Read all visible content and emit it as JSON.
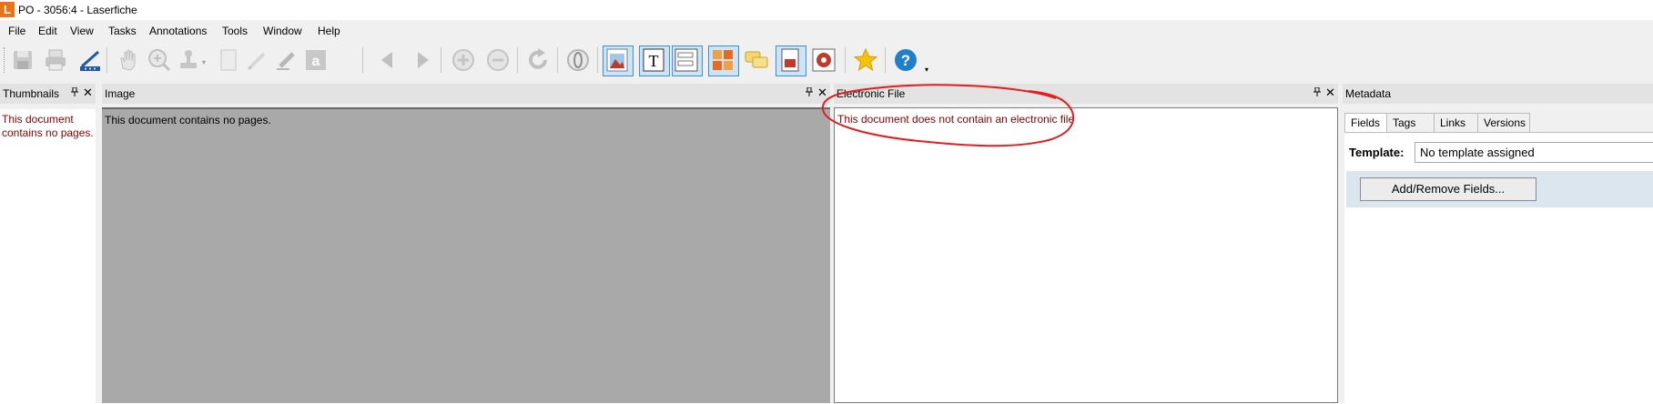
{
  "window": {
    "title": "PO - 3056:4 - Laserfiche",
    "logo_letter": "L",
    "accent": "#e8731a"
  },
  "menu": [
    "File",
    "Edit",
    "View",
    "Tasks",
    "Annotations",
    "Tools",
    "Window",
    "Help"
  ],
  "toolbar": {
    "icons": [
      "save-icon",
      "print-icon",
      "scan-icon",
      "hand-icon",
      "zoom-in-icon",
      "stamp-icon",
      "page-icon",
      "pencil-icon",
      "highlighter-icon",
      "text-annotation-icon",
      "previous-page-icon",
      "next-page-icon",
      "add-icon",
      "remove-icon",
      "refresh-icon",
      "ocr-icon",
      "image-pane-icon",
      "text-pane-icon",
      "metadata-pane-icon",
      "thumbnails-pane-icon",
      "annotations-pane-icon",
      "electronic-file-pane-icon",
      "settings-icon",
      "favorites-icon",
      "help-icon"
    ]
  },
  "panels": {
    "thumbnails": {
      "title": "Thumbnails",
      "message": "This document contains no pages."
    },
    "image": {
      "title": "Image",
      "message": "This document contains no pages."
    },
    "electronic_file": {
      "title": "Electronic File",
      "message": "This document does not contain an electronic file"
    },
    "metadata": {
      "title": "Metadata",
      "tabs": [
        "Fields",
        "Tags",
        "Links",
        "Versions"
      ],
      "template_label": "Template:",
      "template_value": "No template assigned",
      "add_remove_label": "Add/Remove Fields..."
    }
  },
  "annotation_color": "#e31e1e",
  "error_text_color": "#8b0000"
}
